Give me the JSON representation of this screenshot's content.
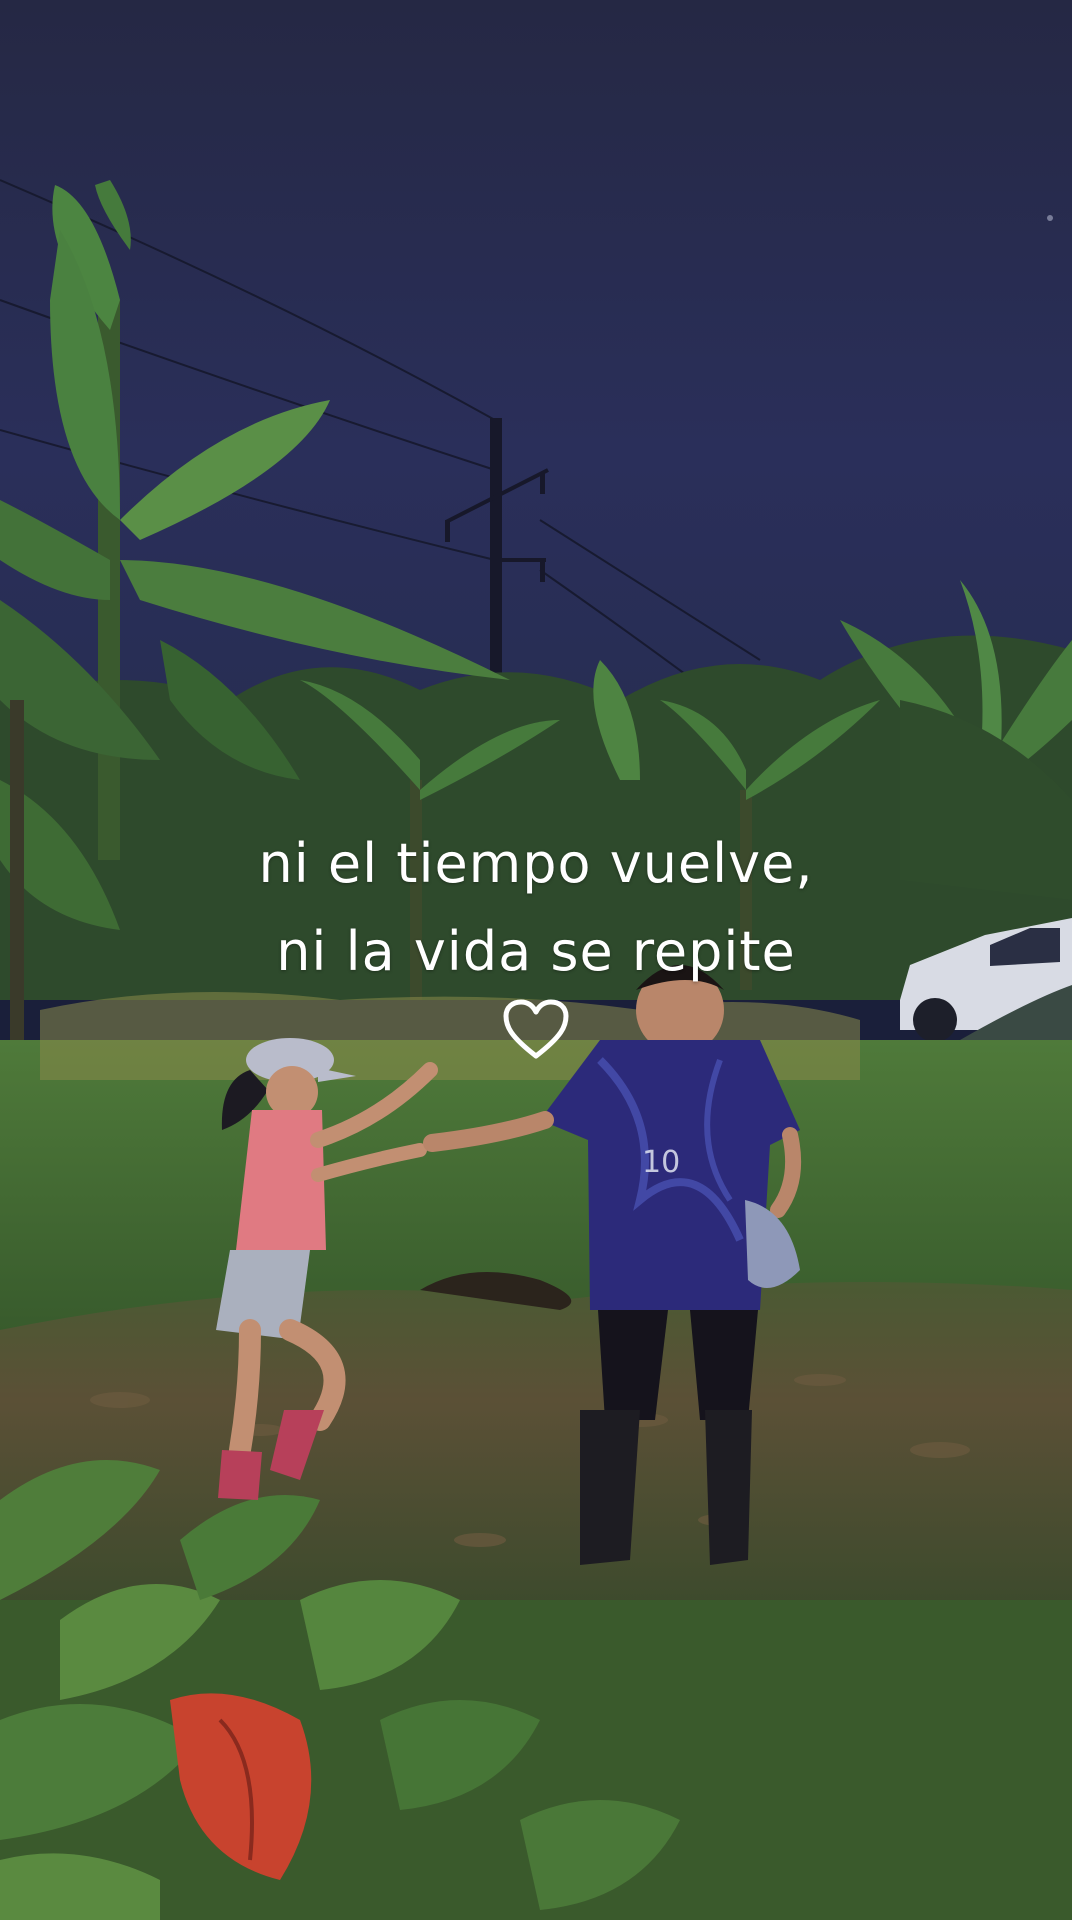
{
  "caption": {
    "line1": "ni el tiempo vuelve,",
    "line2": "ni la vida se repite"
  },
  "icons": {
    "heart": "heart-outline-icon"
  },
  "colors": {
    "sky": "#262a4f",
    "foliage": "#3f6b3a",
    "caption_text": "#ffffff",
    "girl_shirt": "#e07a82",
    "boy_jersey": "#2c2a7a"
  }
}
